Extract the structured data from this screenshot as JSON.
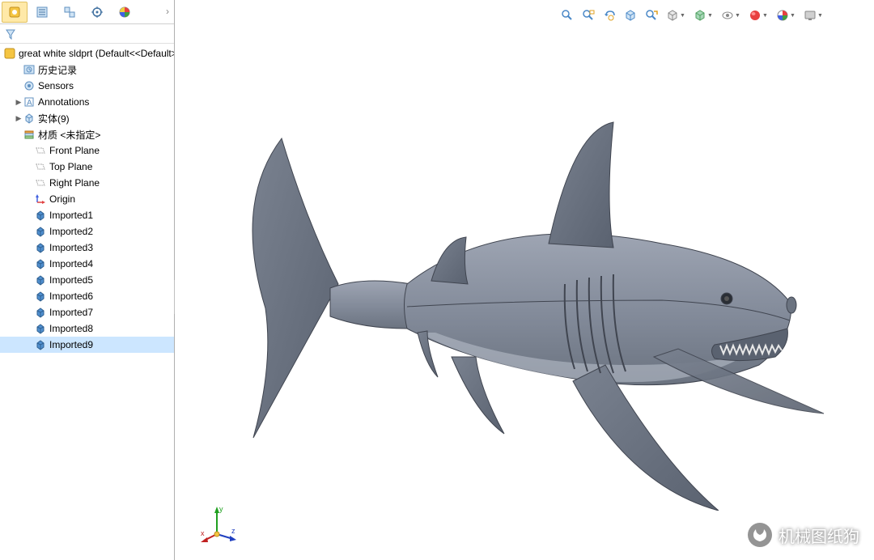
{
  "tree": {
    "root": "great white sldprt  (Default<<Default>",
    "items": [
      {
        "label": "历史记录",
        "icon": "history",
        "indent": 1
      },
      {
        "label": "Sensors",
        "icon": "sensor",
        "indent": 1
      },
      {
        "label": "Annotations",
        "icon": "annotation",
        "indent": 1,
        "caret": "▶"
      },
      {
        "label": "实体(9)",
        "icon": "solid",
        "indent": 1,
        "caret": "▶"
      },
      {
        "label": "材质 <未指定>",
        "icon": "material",
        "indent": 1
      },
      {
        "label": "Front Plane",
        "icon": "plane",
        "indent": 2
      },
      {
        "label": "Top Plane",
        "icon": "plane",
        "indent": 2
      },
      {
        "label": "Right Plane",
        "icon": "plane",
        "indent": 2
      },
      {
        "label": "Origin",
        "icon": "origin",
        "indent": 2
      },
      {
        "label": "Imported1",
        "icon": "import",
        "indent": 2
      },
      {
        "label": "Imported2",
        "icon": "import",
        "indent": 2
      },
      {
        "label": "Imported3",
        "icon": "import",
        "indent": 2
      },
      {
        "label": "Imported4",
        "icon": "import",
        "indent": 2
      },
      {
        "label": "Imported5",
        "icon": "import",
        "indent": 2
      },
      {
        "label": "Imported6",
        "icon": "import",
        "indent": 2
      },
      {
        "label": "Imported7",
        "icon": "import",
        "indent": 2
      },
      {
        "label": "Imported8",
        "icon": "import",
        "indent": 2
      },
      {
        "label": "Imported9",
        "icon": "import",
        "indent": 2,
        "selected": true
      }
    ]
  },
  "triad": {
    "x": "x",
    "y": "y",
    "z": "z"
  },
  "watermark": {
    "text": "机械图纸狗"
  },
  "toolbar_icons": [
    "zoom-fit",
    "zoom-area",
    "prev-view",
    "section",
    "display-style",
    "deform",
    "view-orientation",
    "hide-show",
    "appearance",
    "scene",
    "render-tools"
  ],
  "tab_icons": [
    "feature-manager",
    "property-manager",
    "config-manager",
    "dimx",
    "display-manager"
  ]
}
